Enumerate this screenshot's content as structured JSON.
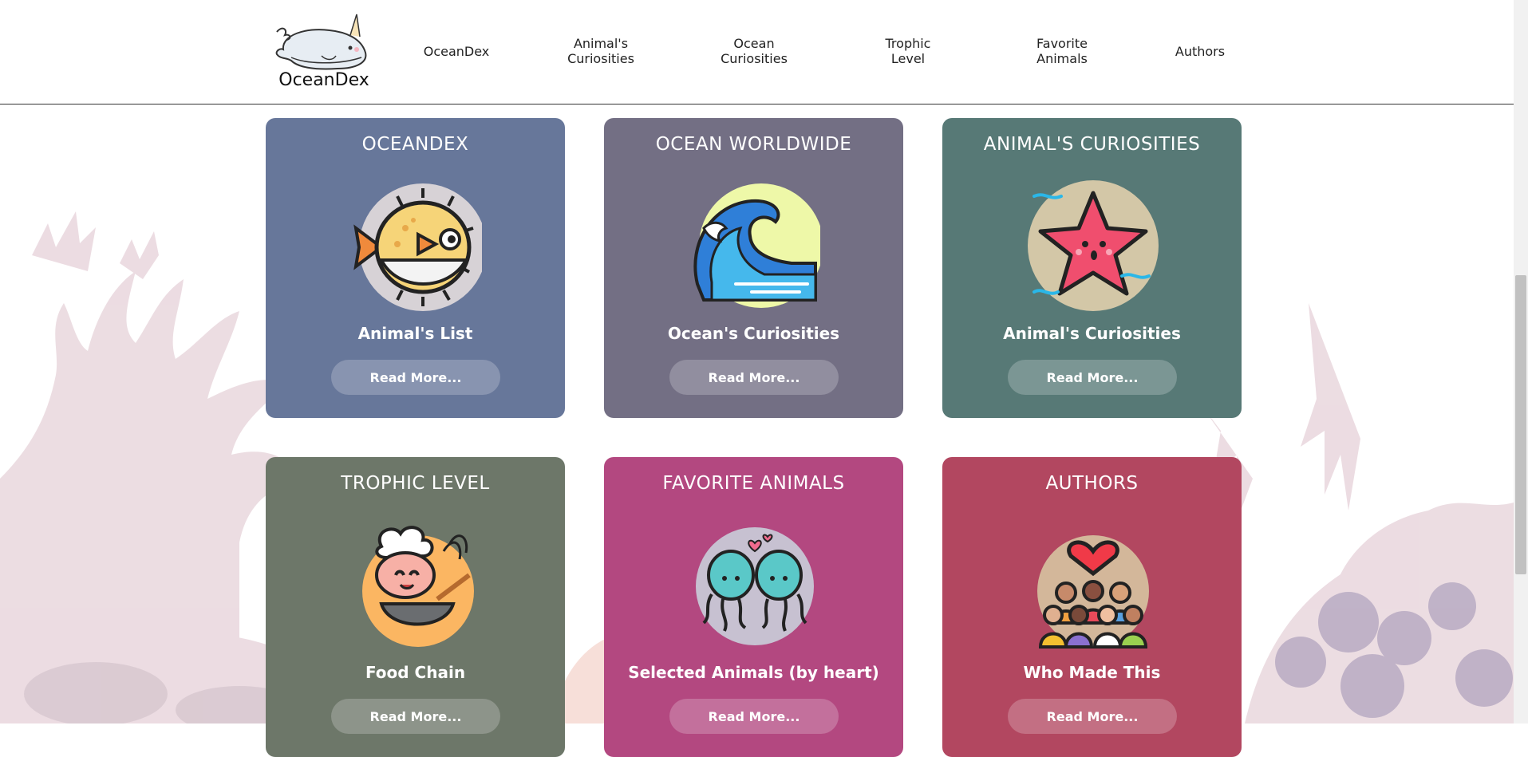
{
  "header": {
    "logo_text": "OceanDex",
    "nav": [
      {
        "label": "OceanDex"
      },
      {
        "label": "Animal's\nCuriosities"
      },
      {
        "label": "Ocean\nCuriosities"
      },
      {
        "label": "Trophic\nLevel"
      },
      {
        "label": "Favorite\nAnimals"
      },
      {
        "label": "Authors"
      }
    ]
  },
  "cards": [
    {
      "title": "OCEANDEX",
      "subtitle": "Animal's List",
      "button": "Read More...",
      "color": "#67779a",
      "icon": "pufferfish-icon"
    },
    {
      "title": "OCEAN WORLDWIDE",
      "subtitle": "Ocean's Curiosities",
      "button": "Read More...",
      "color": "#736f84",
      "icon": "wave-icon"
    },
    {
      "title": "ANIMAL'S CURIOSITIES",
      "subtitle": "Animal's Curiosities",
      "button": "Read More...",
      "color": "#577976",
      "icon": "starfish-icon"
    },
    {
      "title": "TROPHIC LEVEL",
      "subtitle": "Food Chain",
      "button": "Read More...",
      "color": "#6d7769",
      "icon": "shrimp-chef-icon"
    },
    {
      "title": "FAVORITE ANIMALS",
      "subtitle": "Selected Animals (by heart)",
      "button": "Read More...",
      "color": "#b34880",
      "icon": "octopus-couple-icon"
    },
    {
      "title": "AUTHORS",
      "subtitle": "Who Made This",
      "button": "Read More...",
      "color": "#b24760",
      "icon": "team-heart-icon"
    }
  ]
}
